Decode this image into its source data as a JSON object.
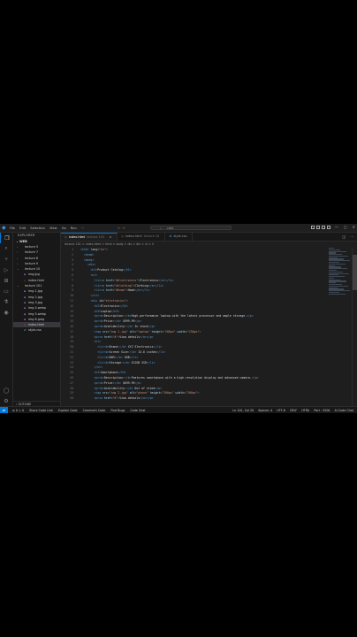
{
  "titlebar": {
    "menu": [
      "File",
      "Edit",
      "Selection",
      "View",
      "Go",
      "Run",
      "···"
    ],
    "search_placeholder": "cats",
    "window_controls": [
      "—",
      "▢",
      "✕"
    ]
  },
  "sidebar": {
    "header": "EXPLORER",
    "root": "WEB",
    "items": [
      {
        "label": "lecture 5",
        "type": "folder",
        "indent": 1
      },
      {
        "label": "lecture 7",
        "type": "folder",
        "indent": 1
      },
      {
        "label": "lecture 8",
        "type": "folder",
        "indent": 1
      },
      {
        "label": "lecture 9",
        "type": "folder",
        "indent": 1
      },
      {
        "label": "lecture 10",
        "type": "folder-open",
        "indent": 1
      },
      {
        "label": "img.jpg",
        "type": "image",
        "indent": 2
      },
      {
        "label": "index.html",
        "type": "html",
        "indent": 2
      },
      {
        "label": "lecture 101",
        "type": "folder-open",
        "indent": 1
      },
      {
        "label": "img 1.jpg",
        "type": "image",
        "indent": 2
      },
      {
        "label": "img 2.jpg",
        "type": "image",
        "indent": 2
      },
      {
        "label": "img 3.jpg",
        "type": "image",
        "indent": 2
      },
      {
        "label": "img 4.webp",
        "type": "image",
        "indent": 2
      },
      {
        "label": "img 5.webp",
        "type": "image",
        "indent": 2
      },
      {
        "label": "img 6.jpeg",
        "type": "image",
        "indent": 2
      },
      {
        "label": "index.html",
        "type": "html",
        "indent": 2,
        "selected": true
      },
      {
        "label": "style.css",
        "type": "css",
        "indent": 2
      }
    ],
    "outline": "OUTLINE"
  },
  "tabs": [
    {
      "label": "index.html",
      "sub": "lecture 101",
      "icon": "html",
      "active": true
    },
    {
      "label": "index.html",
      "sub": "lecture 10",
      "icon": "html",
      "active": false
    },
    {
      "label": "style.css",
      "sub": "",
      "icon": "css",
      "active": false
    }
  ],
  "breadcrumb": "lecture 101 > index.html > html > body > div > div > ul > li",
  "editor": {
    "lines": [
      {
        "n": "1",
        "html": "<span class=\"tg\">&lt;html</span> <span class=\"at\">lang</span>=<span class=\"st\">\"en\"</span><span class=\"tg\">&gt;</span>"
      },
      {
        "n": "2",
        "html": "  <span class=\"tg\">&lt;head&gt;</span>"
      },
      {
        "n": "3",
        "html": "  <span class=\"tg\">&lt;body&gt;</span>"
      },
      {
        "n": "4",
        "html": "    <span class=\"tg\">&lt;div&gt;</span>"
      },
      {
        "n": "5",
        "html": "      <span class=\"tg\">&lt;h1&gt;</span><span class=\"tx\">Product Catalog</span><span class=\"tg\">&lt;/h1&gt;</span>"
      },
      {
        "n": "6",
        "html": "      <span class=\"tg\">&lt;ul&gt;</span>"
      },
      {
        "n": "7",
        "html": "        <span class=\"tg\">&lt;li&gt;&lt;a</span> <span class=\"at\">href</span>=<span class=\"st\">\"#electronics\"</span><span class=\"tg\">&gt;</span><span class=\"tx\">Electronics</span><span class=\"tg\">&lt;/a&gt;&lt;/li&gt;</span>"
      },
      {
        "n": "8",
        "html": "        <span class=\"tg\">&lt;li&gt;&lt;a</span> <span class=\"at\">href</span>=<span class=\"st\">\"#clothing\"</span><span class=\"tg\">&gt;</span><span class=\"tx\">Clothing</span><span class=\"tg\">&lt;/a&gt;&lt;/li&gt;</span>"
      },
      {
        "n": "9",
        "html": "        <span class=\"tg\">&lt;li&gt;&lt;a</span> <span class=\"at\">href</span>=<span class=\"st\">\"#home\"</span><span class=\"tg\">&gt;</span><span class=\"tx\">Home</span><span class=\"tg\">&lt;/a&gt;&lt;/li&gt;</span>"
      },
      {
        "n": "10",
        "html": "      <span class=\"tg\">&lt;/ul&gt;</span>"
      },
      {
        "n": "11",
        "html": "      <span class=\"tg\">&lt;div</span> <span class=\"at\">id</span>=<span class=\"st\">\"electronics\"</span><span class=\"tg\">&gt;</span>"
      },
      {
        "n": "12",
        "html": "        <span class=\"tg\">&lt;h2&gt;</span><span class=\"tx\">Electronics</span><span class=\"tg\">&lt;/h2&gt;</span>"
      },
      {
        "n": "13",
        "html": "        <span class=\"tg\">&lt;h3&gt;</span><span class=\"tx\">Laptop</span><span class=\"tg\">&lt;/h3&gt;</span>"
      },
      {
        "n": "14",
        "html": "        <span class=\"tg\">&lt;p&gt;&lt;b&gt;</span><span class=\"tx\">Description:</span><span class=\"tg\">&lt;/b&gt;</span><span class=\"tx\">High-performance laptop with the latest processor and ample storage.</span><span class=\"tg\">&lt;/p&gt;</span>"
      },
      {
        "n": "15",
        "html": "        <span class=\"tg\">&lt;p&gt;&lt;b&gt;</span><span class=\"tx\">Price:</span><span class=\"tg\">&lt;/b&gt;</span><span class=\"tx\"> $999.99</span><span class=\"tg\">&lt;/p&gt;</span>"
      },
      {
        "n": "16",
        "html": "        <span class=\"tg\">&lt;p&gt;&lt;b&gt;</span><span class=\"tx\">Availability:</span><span class=\"tg\">&lt;/b&gt;</span><span class=\"tx\"> In stock</span><span class=\"tg\">&lt;/p&gt;</span>"
      },
      {
        "n": "17",
        "html": "        <span class=\"tg\">&lt;img</span> <span class=\"at\">src</span>=<span class=\"st\">\"img 1.jpg\"</span> <span class=\"at\">alt</span>=<span class=\"st\">\"laptop\"</span> <span class=\"at\">height</span>=<span class=\"st\">\"200px\"</span> <span class=\"at\">width</span>=<span class=\"st\">\"250px\"</span><span class=\"tg\">&gt;</span>"
      },
      {
        "n": "18",
        "html": "        <span class=\"tg\">&lt;p&gt;&lt;a</span> <span class=\"at\">href</span>=<span class=\"st\">\"#\"</span><span class=\"tg\">&gt;</span><span class=\"tx\">View details</span><span class=\"tg\">&lt;/a&gt;&lt;/p&gt;</span>"
      },
      {
        "n": "19",
        "html": "        <span class=\"tg\">&lt;ul&gt;</span>"
      },
      {
        "n": "20",
        "html": "          <span class=\"tg\">&lt;li&gt;&lt;b&gt;</span><span class=\"tx\">Brand:</span><span class=\"tg\">&lt;/b&gt;</span><span class=\"tx\"> XYZ Electronics</span><span class=\"tg\">&lt;/li&gt;</span>"
      },
      {
        "n": "21",
        "html": "          <span class=\"tg\">&lt;li&gt;&lt;b&gt;</span><span class=\"tx\">Screen Size:</span><span class=\"tg\">&lt;/b&gt;</span><span class=\"tx\"> 15.6 inches</span><span class=\"tg\">&lt;/li&gt;</span>"
      },
      {
        "n": "22",
        "html": "          <span class=\"tg\">&lt;li&gt;&lt;b&gt;</span><span class=\"tx\">RAM:</span><span class=\"tg\">&lt;/b&gt;</span><span class=\"tx\"> 8GB</span><span class=\"tg\">&lt;/li&gt;</span>"
      },
      {
        "n": "23",
        "html": "          <span class=\"tg\">&lt;li&gt;&lt;b&gt;</span><span class=\"tx\">Storage:</span><span class=\"tg\">&lt;/b&gt;</span><span class=\"tx\"> 512GB SSD</span><span class=\"tg\">&lt;/li&gt;</span>"
      },
      {
        "n": "24",
        "html": "        <span class=\"tg\">&lt;/ul&gt;</span>"
      },
      {
        "n": "25",
        "html": "        <span class=\"tg\">&lt;h3&gt;</span><span class=\"tx\">Smartphone</span><span class=\"tg\">&lt;/h3&gt;</span>"
      },
      {
        "n": "26",
        "html": "        <span class=\"tg\">&lt;p&gt;&lt;b&gt;</span><span class=\"tx\">Description:</span><span class=\"tg\">&lt;/b&gt;</span><span class=\"tx\">Features smartphone with a high-resolution display and advanced camera.</span><span class=\"tg\">&lt;/p&gt;</span>"
      },
      {
        "n": "27",
        "html": "        <span class=\"tg\">&lt;p&gt;&lt;b&gt;</span><span class=\"tx\">Price:</span><span class=\"tg\">&lt;/b&gt;</span><span class=\"tx\"> $699.99</span><span class=\"tg\">&lt;/p&gt;</span>"
      },
      {
        "n": "28",
        "html": "        <span class=\"tg\">&lt;p&gt;&lt;b&gt;</span><span class=\"tx\">Availability:</span><span class=\"tg\">&lt;/b&gt;</span><span class=\"tx\"> Out of stock</span><span class=\"tg\">&lt;/p&gt;</span>"
      },
      {
        "n": "29",
        "html": "        <span class=\"tg\">&lt;img</span> <span class=\"at\">src</span>=<span class=\"st\">\"img 2.jpg\"</span> <span class=\"at\">alt</span>=<span class=\"st\">\"phone\"</span> <span class=\"at\">height</span>=<span class=\"st\">\"200px\"</span> <span class=\"at\">width</span>=<span class=\"st\">\"200px\"</span><span class=\"tg\">&gt;</span>"
      },
      {
        "n": "30",
        "html": "        <span class=\"tg\">&lt;p&gt;&lt;a</span> <span class=\"at\">href</span>=<span class=\"st\">\"#\"</span><span class=\"tg\">&gt;</span><span class=\"tx\">View details</span><span class=\"tg\">&lt;/a&gt;&lt;/p&gt;</span>"
      }
    ]
  },
  "statusbar": {
    "left": [
      "⊗ 0 ⚠ 0",
      "Share Code Link",
      "Explain Code",
      "Comment Code",
      "Find Bugs",
      "Code Chat"
    ],
    "right": [
      "Ln 101, Col 20",
      "Spaces: 4",
      "UTF-8",
      "CRLF",
      "HTML",
      "Port : 5500",
      "AI Code Chat"
    ]
  }
}
